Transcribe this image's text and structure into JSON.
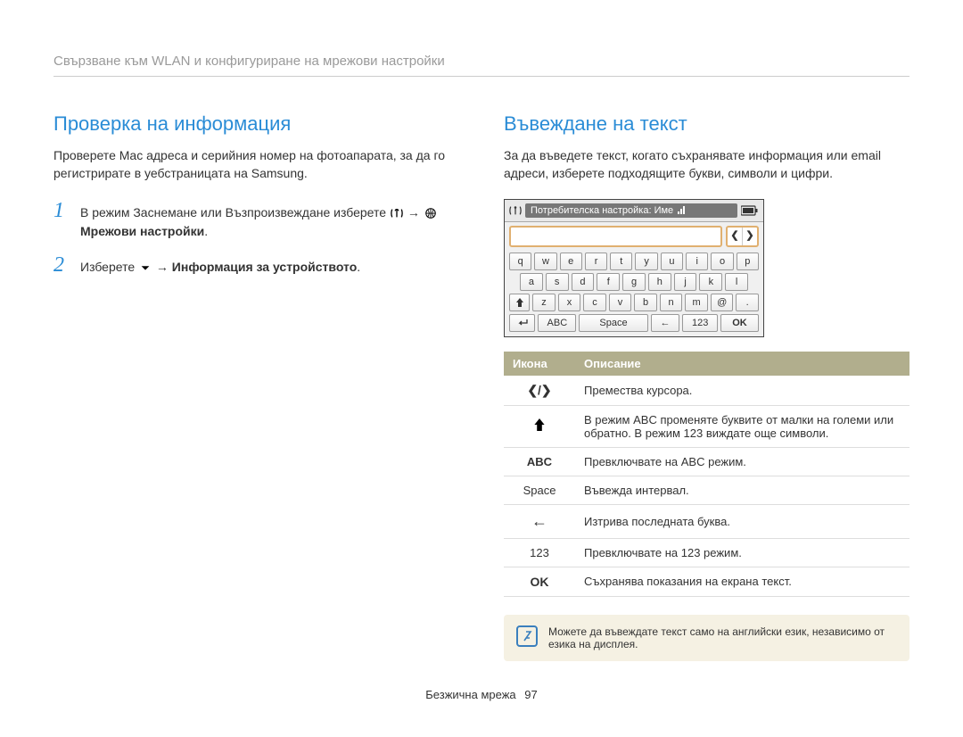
{
  "header": {
    "breadcrumb": "Свързване към WLAN и конфигуриране на мрежови настройки"
  },
  "left": {
    "title": "Проверка на информация",
    "intro": "Проверете Mac адреса и серийния номер на фотоапарата, за да го регистрирате в уебстраницата на Samsung.",
    "steps": [
      {
        "num": "1",
        "text_pre": "В режим Заснемане или Възпроизвеждане изберете ",
        "arrow": "→",
        "bold_after_icons": " Мрежови настройки",
        "bold_tail": "."
      },
      {
        "num": "2",
        "text_pre": "Изберете ",
        "arrow": "→",
        "bold": "Информация за устройството",
        "bold_tail": "."
      }
    ]
  },
  "right": {
    "title": "Въвеждане на текст",
    "intro": "За да въведете текст, когато съхранявате информация или email адреси, изберете подходящите букви, символи и цифри."
  },
  "keyboard": {
    "bar_title": "Потребителска настройка: Име",
    "row1": [
      "q",
      "w",
      "e",
      "r",
      "t",
      "y",
      "u",
      "i",
      "o",
      "p"
    ],
    "row2": [
      "a",
      "s",
      "d",
      "f",
      "g",
      "h",
      "j",
      "k",
      "l"
    ],
    "row3": [
      "z",
      "x",
      "c",
      "v",
      "b",
      "n",
      "m",
      "@",
      "."
    ],
    "bottom": {
      "abc": "ABC",
      "space": "Space",
      "back": "←",
      "num": "123",
      "ok": "OK"
    },
    "arrows": {
      "left": "❮",
      "right": "❯"
    }
  },
  "table": {
    "header": {
      "icon": "Икона",
      "desc": "Описание"
    },
    "rows": [
      {
        "icon": "❮/❯",
        "desc": "Премества курсора."
      },
      {
        "icon": "shift",
        "desc": "В режим ABC променяте буквите от малки на големи или обратно. В режим 123 виждате още символи."
      },
      {
        "icon_text": "ABC",
        "desc": "Превключвате на ABC режим."
      },
      {
        "icon_text": "Space",
        "desc": "Въвежда интервал."
      },
      {
        "icon": "←",
        "desc": "Изтрива последната буква."
      },
      {
        "icon_text": "123",
        "desc": "Превключвате на 123 режим."
      },
      {
        "icon_text": "OK",
        "desc": "Съхранява показания на екрана текст."
      }
    ]
  },
  "note": {
    "text": "Можете да въвеждате текст само на английски език, независимо от езика на дисплея."
  },
  "footer": {
    "section": "Безжична мрежа",
    "page": "97"
  }
}
